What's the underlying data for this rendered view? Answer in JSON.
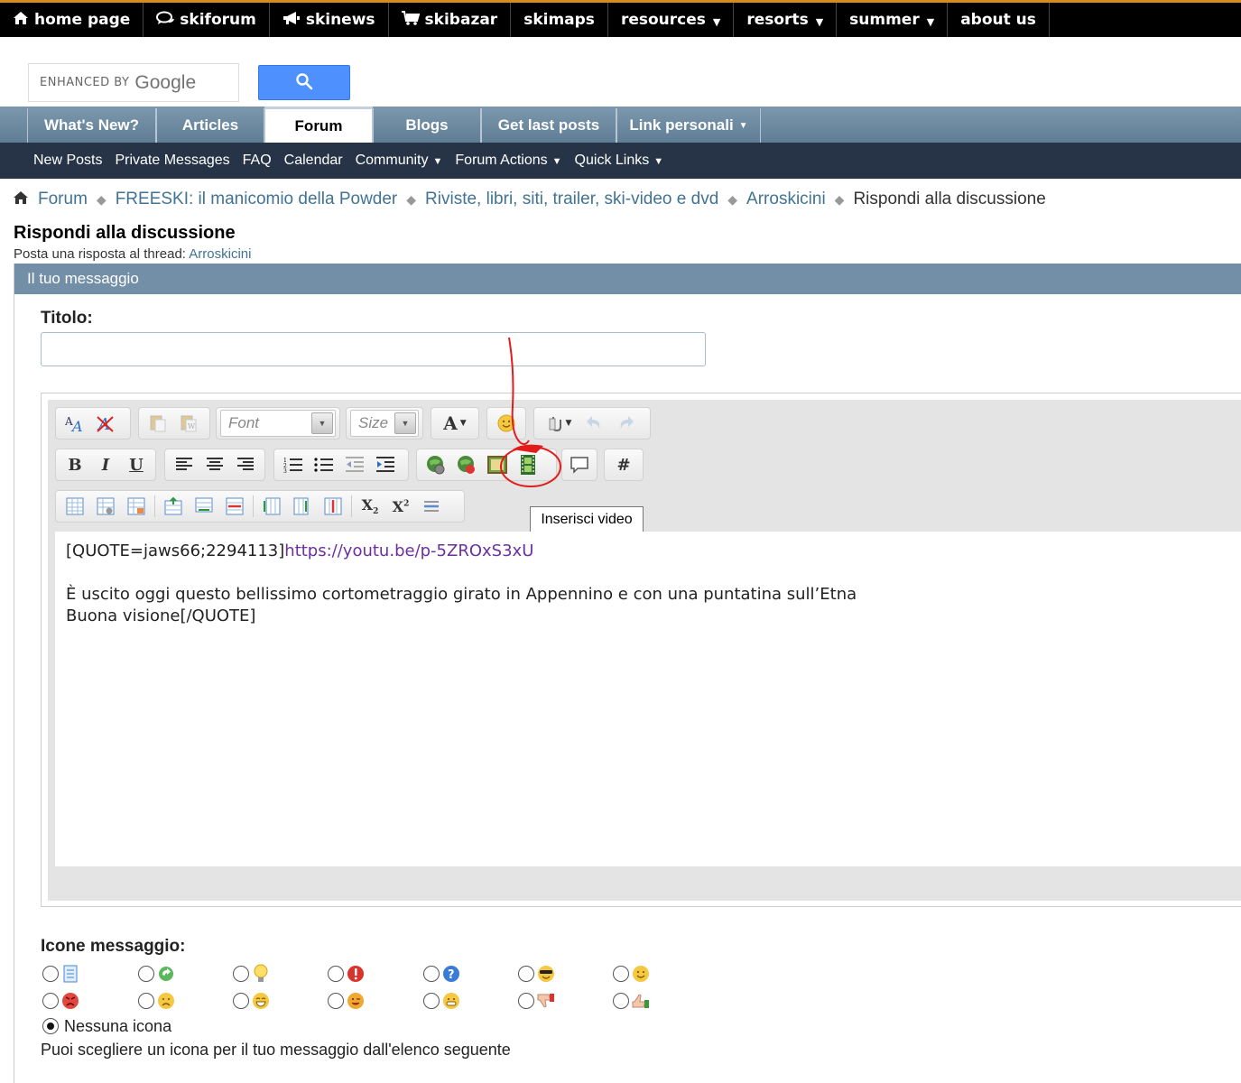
{
  "topnav": [
    {
      "label": "home page",
      "icon": "home-icon",
      "dropdown": false
    },
    {
      "label": "skiforum",
      "icon": "chat-icon",
      "dropdown": false
    },
    {
      "label": "skinews",
      "icon": "megaphone-icon",
      "dropdown": false
    },
    {
      "label": "skibazar",
      "icon": "cart-icon",
      "dropdown": false
    },
    {
      "label": "skimaps",
      "icon": "",
      "dropdown": false
    },
    {
      "label": "resources",
      "icon": "",
      "dropdown": true
    },
    {
      "label": "resorts",
      "icon": "",
      "dropdown": true
    },
    {
      "label": "summer",
      "icon": "",
      "dropdown": true
    },
    {
      "label": "about us",
      "icon": "",
      "dropdown": false
    }
  ],
  "search": {
    "enhanced_by": "ENHANCED BY",
    "google": "Google",
    "button_icon": "search-icon",
    "accent": "#4d90fe"
  },
  "tabs": [
    {
      "label": "What's New?"
    },
    {
      "label": "Articles"
    },
    {
      "label": "Forum"
    },
    {
      "label": "Blogs"
    },
    {
      "label": "Get last posts"
    },
    {
      "label": "Link personali"
    }
  ],
  "subnav": [
    {
      "label": "New Posts"
    },
    {
      "label": "Private Messages"
    },
    {
      "label": "FAQ"
    },
    {
      "label": "Calendar"
    },
    {
      "label": "Community"
    },
    {
      "label": "Forum Actions"
    },
    {
      "label": "Quick Links"
    }
  ],
  "breadcrumb": [
    {
      "label": "Forum"
    },
    {
      "label": "FREESKI: il manicomio della Powder"
    },
    {
      "label": "Riviste, libri, siti, trailer, ski-video e dvd"
    },
    {
      "label": "Arroskicini"
    },
    {
      "label": "Rispondi alla discussione"
    }
  ],
  "page": {
    "title": "Rispondi alla discussione",
    "subtitle_prefix": "Posta una risposta al thread:",
    "thread_link": "Arroskicini"
  },
  "panel": {
    "heading": "Il tuo messaggio",
    "color": "#738fa7"
  },
  "form": {
    "title_label": "Titolo:",
    "title_value": ""
  },
  "editor": {
    "font_combo": "Font",
    "size_combo": "Size",
    "tooltip": "Inserisci video",
    "line1_prefix": "[QUOTE=jaws66;2294113]",
    "line1_link": "https://youtu.be/p-5ZROxS3xU",
    "line2": "È uscito oggi questo bellissimo cortometraggio girato in Appennino e con una puntatina sull’Etna",
    "line3": "Buona visione[/QUOTE]"
  },
  "message_icons": {
    "label": "Icone messaggio:",
    "none_label": "Nessuna icona",
    "help": "Puoi scegliere un icona per il tuo messaggio dall'elenco seguente"
  }
}
